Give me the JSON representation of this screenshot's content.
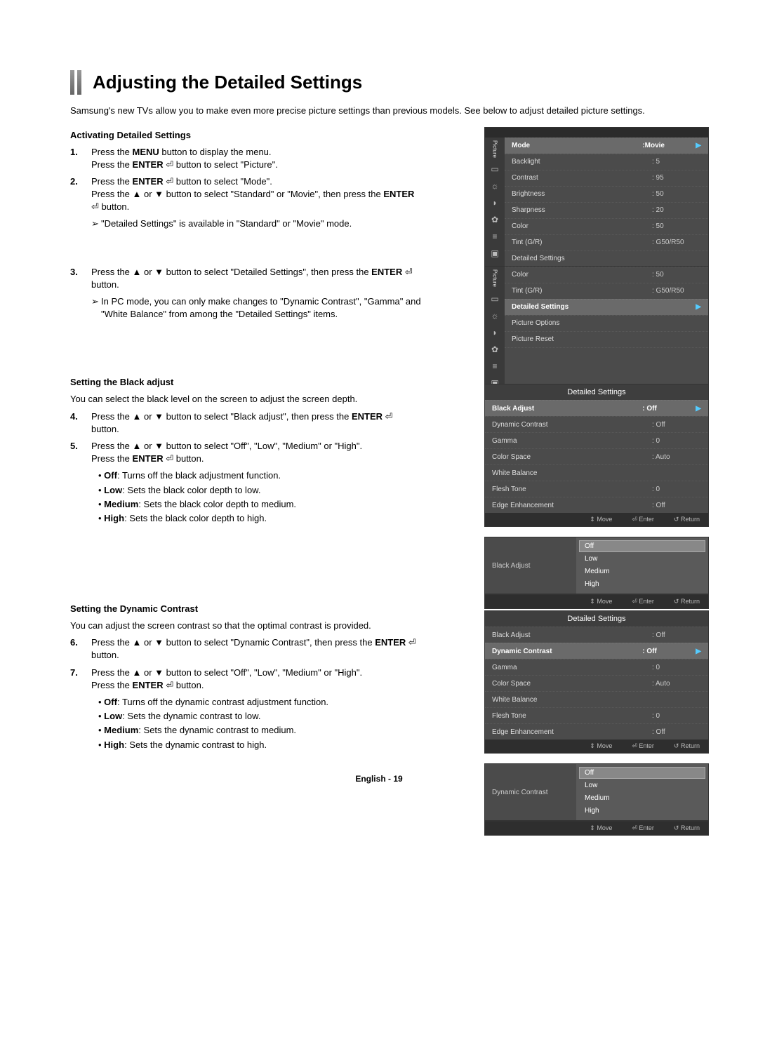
{
  "title": "Adjusting the Detailed Settings",
  "intro": "Samsung's new TVs allow you to make even more precise picture settings than previous models. See below to adjust detailed picture settings.",
  "sections": {
    "activating": {
      "heading": "Activating Detailed Settings",
      "steps": {
        "s1": {
          "num": "1.",
          "line1a": "Press the ",
          "line1b": "MENU",
          "line1c": " button to display the menu.",
          "line2a": "Press the ",
          "line2b": "ENTER",
          "line2c": " button to select \"Picture\"."
        },
        "s2": {
          "num": "2.",
          "line1a": "Press the ",
          "line1b": "ENTER",
          "line1c": " button to select \"Mode\".",
          "line2a": "Press the ▲ or ▼ button to select \"Standard\" or \"Movie\", then press the ",
          "line2b": "ENTER",
          "line2c": " button."
        },
        "s2note": "\"Detailed Settings\" is available in \"Standard\" or \"Movie\" mode.",
        "s3": {
          "num": "3.",
          "line1a": "Press the ▲ or ▼ button to select \"Detailed Settings\", then press the ",
          "line1b": "ENTER",
          "line1c": " button."
        },
        "s3note": "In PC mode, you can only make changes to \"Dynamic Contrast\", \"Gamma\" and \"White Balance\" from among the \"Detailed Settings\" items."
      }
    },
    "black": {
      "heading": "Setting the Black adjust",
      "lead": "You can select the black level on the screen to adjust the screen depth.",
      "s4": {
        "num": "4.",
        "text1": "Press the ▲ or ▼ button to select \"Black adjust\", then press the ",
        "text2": "ENTER",
        "text3": " button."
      },
      "s5": {
        "num": "5.",
        "text1": "Press the ▲ or ▼ button to select \"Off\", \"Low\", \"Medium\" or \"High\".",
        "text2a": "Press the ",
        "text2b": "ENTER",
        "text2c": " button."
      },
      "opts": {
        "off": {
          "k": "Off",
          "t": ": Turns off the black adjustment function."
        },
        "low": {
          "k": "Low",
          "t": ": Sets the black color depth to low."
        },
        "med": {
          "k": "Medium",
          "t": ": Sets the black color depth to medium."
        },
        "high": {
          "k": "High",
          "t": ": Sets the black color depth to high."
        }
      }
    },
    "dynamic": {
      "heading": "Setting the Dynamic Contrast",
      "lead": "You can adjust the screen contrast so that the optimal contrast is provided.",
      "s6": {
        "num": "6.",
        "text1": "Press the ▲ or ▼ button to select \"Dynamic Contrast\", then press the ",
        "text2": "ENTER",
        "text3": " button."
      },
      "s7": {
        "num": "7.",
        "text1": "Press the ▲ or ▼ button to select \"Off\", \"Low\", \"Medium\" or \"High\".",
        "text2a": "Press the ",
        "text2b": "ENTER",
        "text2c": " button."
      },
      "opts": {
        "off": {
          "k": "Off",
          "t": ": Turns off the dynamic contrast adjustment function."
        },
        "low": {
          "k": "Low",
          "t": ": Sets the dynamic contrast to low."
        },
        "med": {
          "k": "Medium",
          "t": ": Sets the dynamic contrast to medium."
        },
        "high": {
          "k": "High",
          "t": ": Sets the dynamic contrast to high."
        }
      }
    }
  },
  "osd": {
    "tab": "Picture",
    "menu1": {
      "mode_l": "Mode",
      "mode_v": ":Movie",
      "r1l": "Backlight",
      "r1v": ": 5",
      "r2l": "Contrast",
      "r2v": ": 95",
      "r3l": "Brightness",
      "r3v": ": 50",
      "r4l": "Sharpness",
      "r4v": ": 20",
      "r5l": "Color",
      "r5v": ": 50",
      "r6l": "Tint (G/R)",
      "r6v": ": G50/R50",
      "r7l": "Detailed Settings"
    },
    "menu2": {
      "r1l": "Color",
      "r1v": ": 50",
      "r2l": "Tint (G/R)",
      "r2v": ": G50/R50",
      "sel": "Detailed Settings",
      "r3l": "Picture Options",
      "r4l": "Picture Reset"
    },
    "detailed": {
      "title": "Detailed Settings",
      "r1l": "Black Adjust",
      "r1v": ": Off",
      "r2l": "Dynamic Contrast",
      "r2v": ": Off",
      "r3l": "Gamma",
      "r3v": ": 0",
      "r4l": "Color Space",
      "r4v": ": Auto",
      "r5l": "White Balance",
      "r6l": "Flesh Tone",
      "r6v": ": 0",
      "r7l": "Edge Enhancement",
      "r7v": ": Off"
    },
    "nav": {
      "move": "Move",
      "enter": "Enter",
      "return": "Return"
    },
    "popup_black": {
      "label": "Black Adjust",
      "o1": "Off",
      "o2": "Low",
      "o3": "Medium",
      "o4": "High"
    },
    "popup_dyn": {
      "label": "Dynamic Contrast",
      "o1": "Off",
      "o2": "Low",
      "o3": "Medium",
      "o4": "High"
    }
  },
  "glyphs": {
    "enter": "⏎",
    "updown": "⇕",
    "ret": "↺"
  },
  "footer": "English - 19"
}
